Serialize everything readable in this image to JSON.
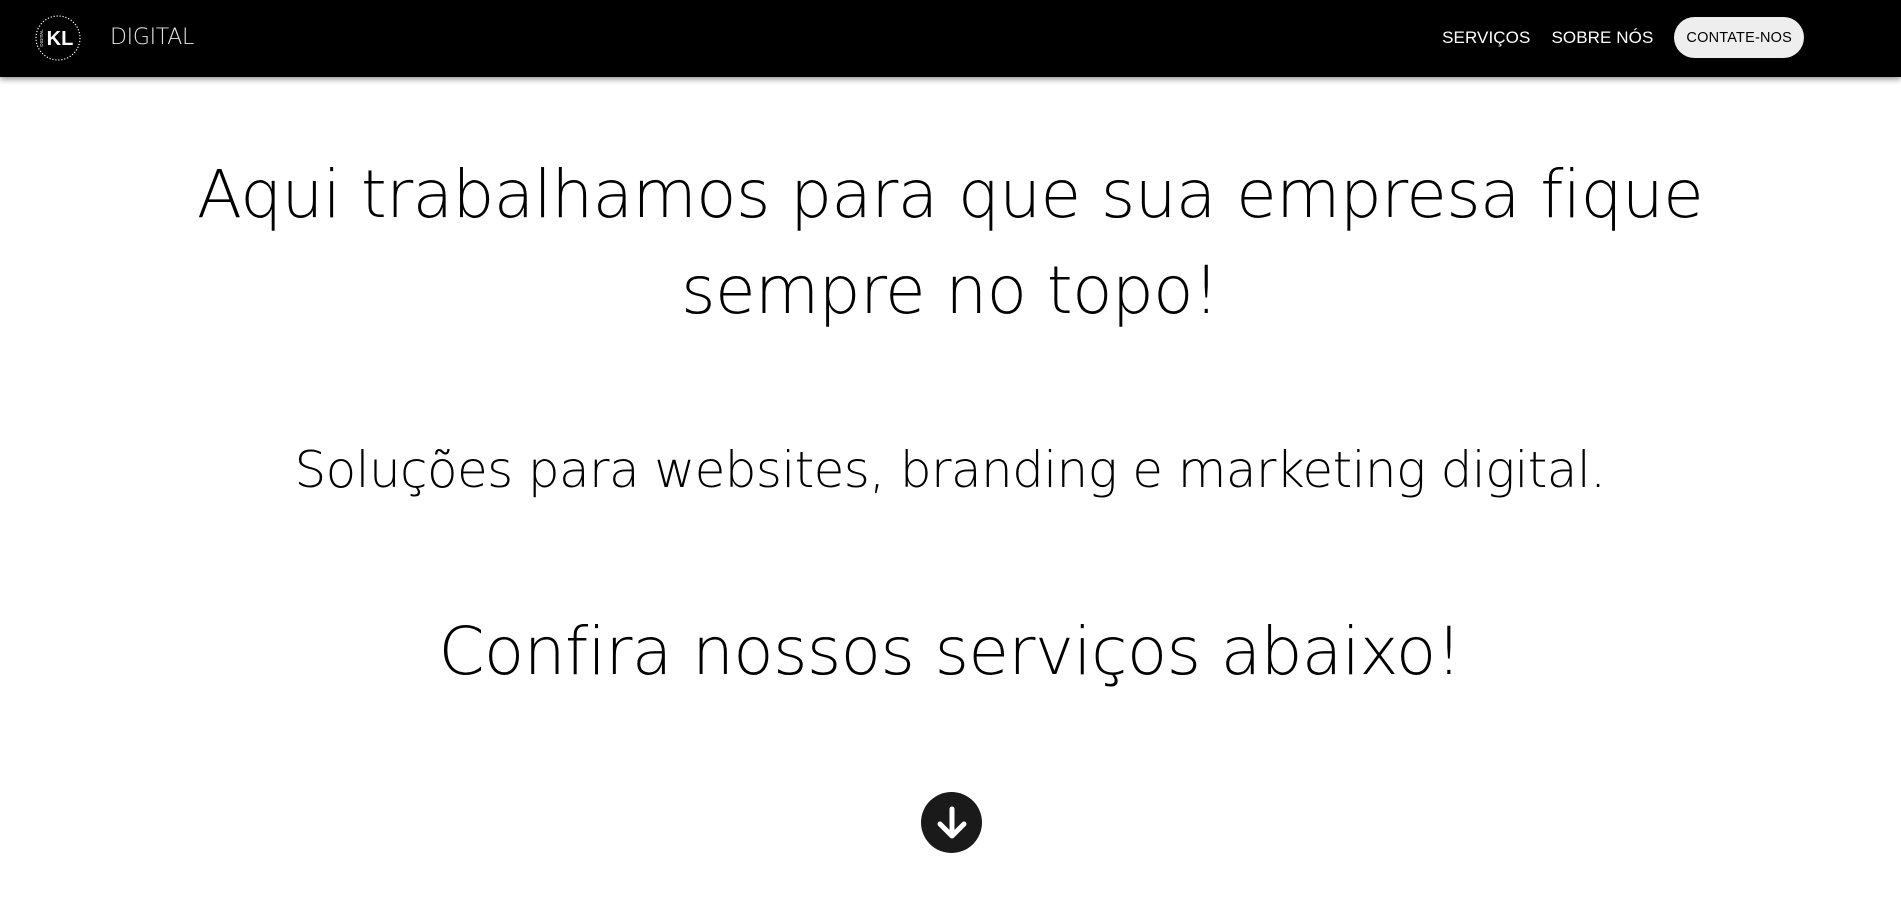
{
  "header": {
    "logo_icon": "kl-digital-logo-icon",
    "logo_mark_text": "KL",
    "logo_side_text": "DIGITAL",
    "brand": "DIGITAL",
    "nav": {
      "services": "SERVIÇOS",
      "about": "SOBRE NÓS",
      "contact": "CONTATE-NOS"
    }
  },
  "hero": {
    "headline_line1": "Aqui trabalhamos para que sua empresa fique",
    "headline_line2": "sempre no topo!",
    "subline": "Soluções para websites, branding e marketing digital.",
    "cta_text": "Confira nossos serviços abaixo!",
    "scroll_icon": "arrow-down-circle-icon"
  },
  "colors": {
    "header_bg": "#000000",
    "page_bg": "#ffffff",
    "contact_button_bg": "#eeeeee",
    "scroll_button_bg": "#1a1a1a"
  }
}
